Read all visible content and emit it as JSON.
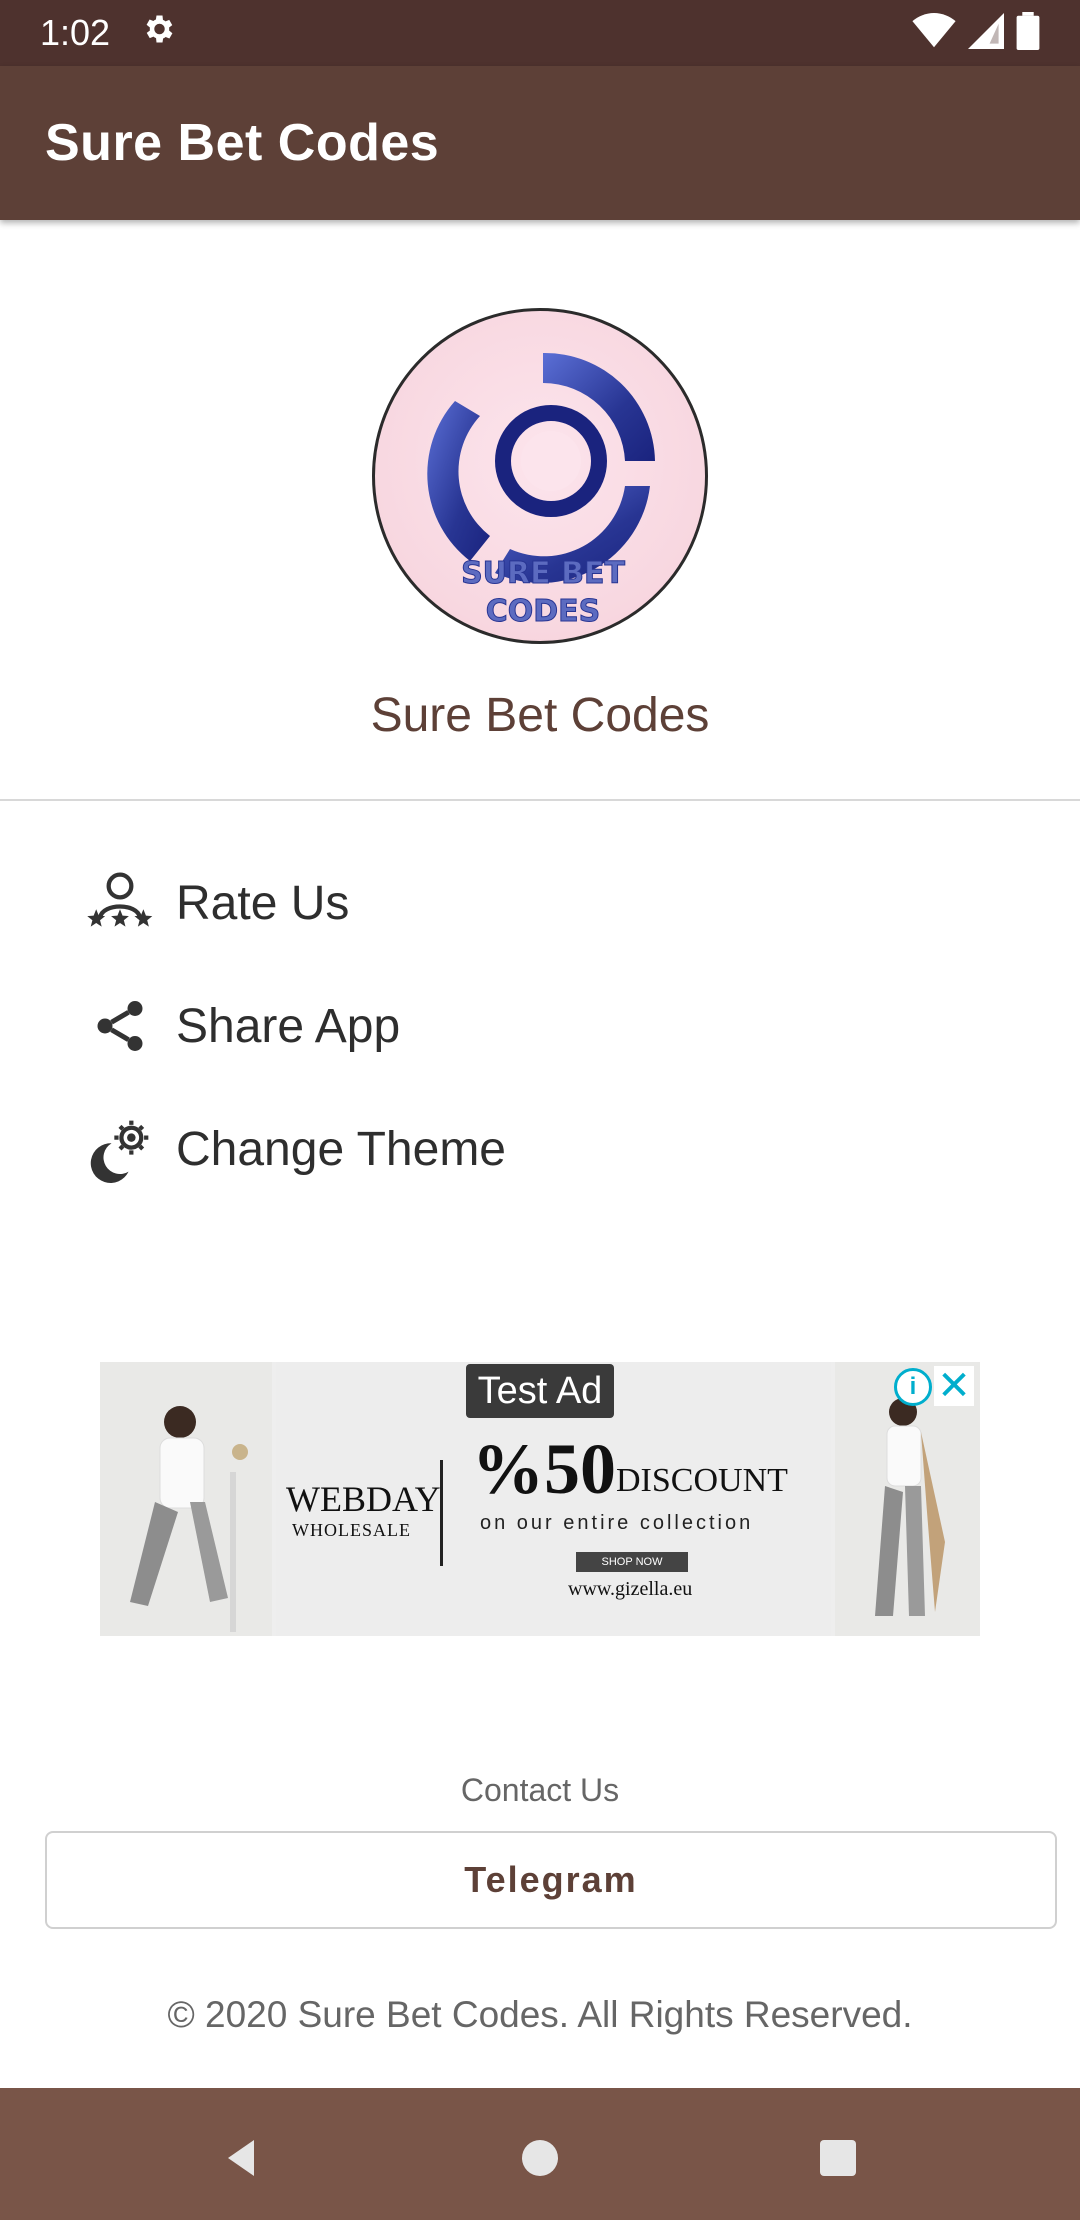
{
  "status_bar": {
    "time": "1:02",
    "icons": [
      "gear-icon",
      "wifi-icon",
      "signal-icon",
      "battery-icon"
    ]
  },
  "app_bar": {
    "title": "Sure Bet Codes"
  },
  "header": {
    "logo_text_line1": "SURE BET",
    "logo_text_line2": "CODES",
    "app_name": "Sure Bet Codes"
  },
  "menu": {
    "items": [
      {
        "label": "Rate Us",
        "icon": "rate-stars-icon"
      },
      {
        "label": "Share App",
        "icon": "share-icon"
      },
      {
        "label": "Change Theme",
        "icon": "theme-icon"
      }
    ]
  },
  "ad": {
    "badge": "Test Ad",
    "brand": "WEBDAY",
    "brand_sub": "WHOLESALE",
    "headline": "%50",
    "headline_suffix": "DISCOUNT",
    "tagline": "on our entire collection",
    "cta": "SHOP NOW",
    "url": "www.gizella.eu",
    "info_icon": "info-icon",
    "close_icon": "close-icon"
  },
  "footer": {
    "contact_label": "Contact Us",
    "telegram_button": "Telegram",
    "copyright": "© 2020 Sure Bet Codes. All Rights Reserved."
  },
  "nav_bar": {
    "icons": [
      "back-icon",
      "home-icon",
      "recents-icon"
    ]
  },
  "colors": {
    "status_bar": "#4e322e",
    "app_bar": "#5d4037",
    "nav_bar": "#795548",
    "accent_text": "#5d4037",
    "ad_icon": "#00aecd"
  }
}
